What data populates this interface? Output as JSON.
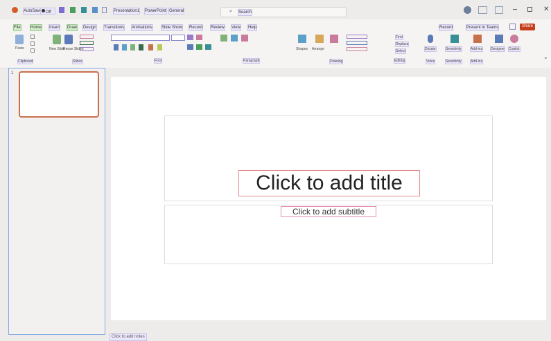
{
  "titlebar": {
    "autosave": "AutoSave",
    "toggle": "Off",
    "presentation": "Presentation1",
    "app": "PowerPoint",
    "label": "General",
    "search_placeholder": "Search"
  },
  "tabs": [
    "File",
    "Home",
    "Insert",
    "Draw",
    "Design",
    "Transitions",
    "Animations",
    "Slide Show",
    "Record",
    "Review",
    "View",
    "Help"
  ],
  "toolbar": {
    "record": "Record",
    "present": "Present in Teams",
    "share": "Share"
  },
  "ribbon": {
    "paste": "Paste",
    "clipboard": "Clipboard",
    "new_slide": "New Slide",
    "reuse": "Reuse Slides",
    "slides": "Slides",
    "font": "Font",
    "paragraph": "Paragraph",
    "shapes": "Shapes",
    "arrange": "Arrange",
    "drawing": "Drawing",
    "editing": "Editing",
    "find": "Find",
    "replace": "Replace",
    "select": "Select",
    "dictate": "Dictate",
    "voice": "Voice",
    "sensitivity": "Sensitivity",
    "addins": "Add-ins",
    "designer": "Designer",
    "copilot": "Copilot"
  },
  "thumbs": {
    "number": "1"
  },
  "slide": {
    "title": "Click to add title",
    "subtitle": "Click to add subtitle"
  },
  "notes": "Click to add notes",
  "colors": {
    "accent": "#c43e1c",
    "selection": "#7fa8e6"
  }
}
